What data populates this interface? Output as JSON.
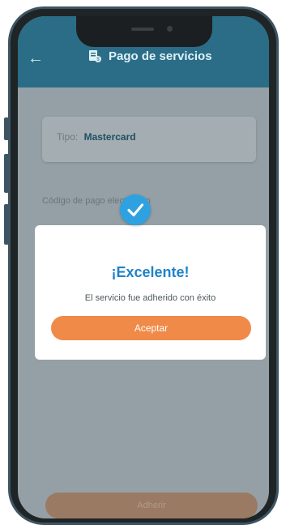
{
  "header": {
    "title": "Pago de servicios",
    "back_icon": "back-arrow-icon",
    "title_icon": "service-payment-icon"
  },
  "card": {
    "label": "Tipo:",
    "value": "Mastercard"
  },
  "form": {
    "code_label": "Código de pago electrónico"
  },
  "modal": {
    "icon": "check-icon",
    "title": "¡Excelente!",
    "message": "El servicio fue adherido con éxito",
    "accept_label": "Aceptar"
  },
  "footer": {
    "button_label": "Adherir"
  },
  "colors": {
    "header": "#2b6d87",
    "accent": "#f08a48",
    "success": "#2ea1e1",
    "title": "#1f83c8"
  }
}
